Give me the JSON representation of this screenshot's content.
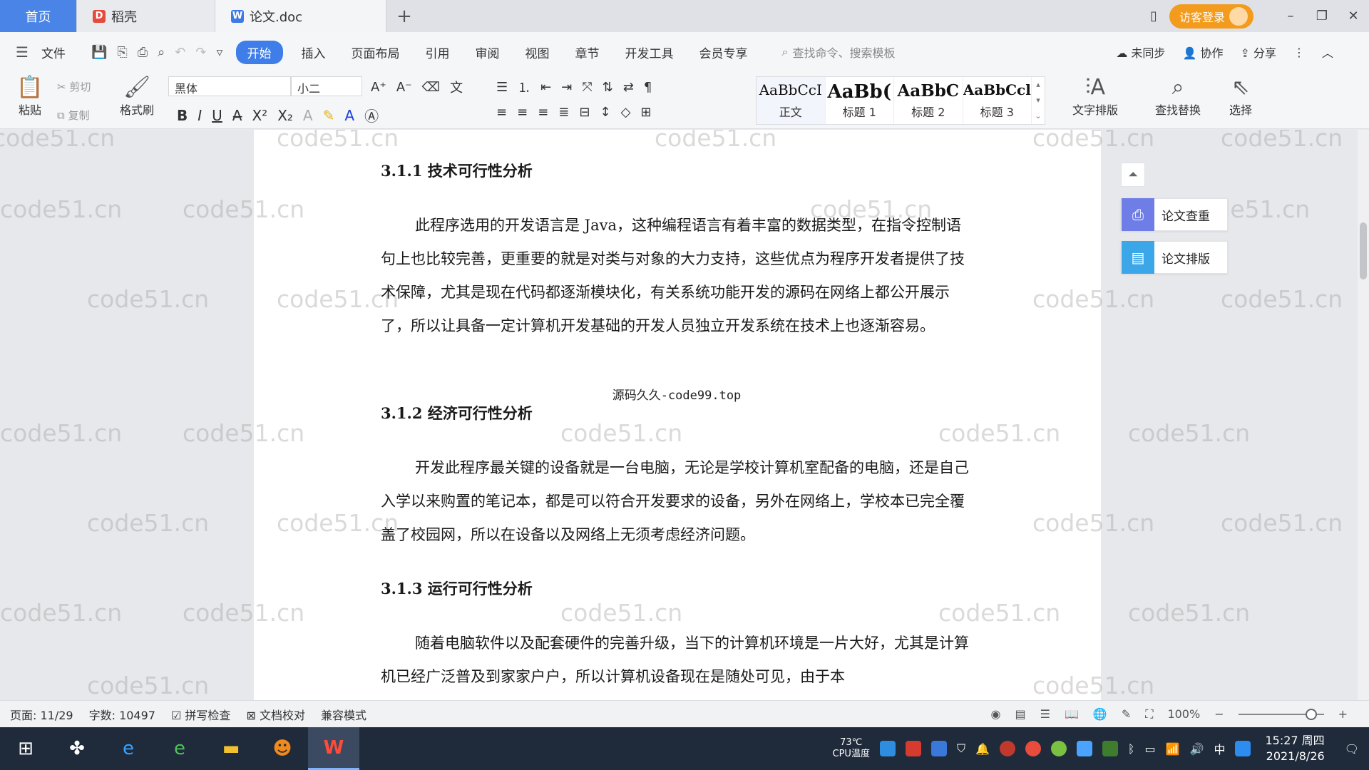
{
  "tabs": {
    "home": "首页",
    "daoke": "稻壳",
    "doc": "论文.doc",
    "add": "+"
  },
  "topright": {
    "login": "访客登录"
  },
  "menu": {
    "file": "文件",
    "items": [
      "开始",
      "插入",
      "页面布局",
      "引用",
      "审阅",
      "视图",
      "章节",
      "开发工具",
      "会员专享"
    ],
    "search_placeholder": "查找命令、搜索模板",
    "sync": "未同步",
    "collab": "协作",
    "share": "分享"
  },
  "ribbon": {
    "paste": "粘贴",
    "cut": "剪切",
    "copy": "复制",
    "format_painter": "格式刷",
    "font_name": "黑体",
    "font_size": "小二",
    "styles": [
      {
        "preview": "AaBbCcI",
        "label": "正文"
      },
      {
        "preview": "AaBb(",
        "label": "标题 1"
      },
      {
        "preview": "AaBbC",
        "label": "标题 2"
      },
      {
        "preview": "AaBbCcl",
        "label": "标题 3"
      }
    ],
    "text_layout": "文字排版",
    "find_replace": "查找替换",
    "select": "选择"
  },
  "watermark": "code51.cn",
  "document": {
    "h1": "3.1.1  技术可行性分析",
    "p1": "此程序选用的开发语言是 Java，这种编程语言有着丰富的数据类型，在指令控制语句上也比较完善，更重要的就是对类与对象的大力支持，这些优点为程序开发者提供了技术保障，尤其是现在代码都逐渐模块化，有关系统功能开发的源码在网络上都公开展示了，所以让具备一定计算机开发基础的开发人员独立开发系统在技术上也逐渐容易。",
    "note": "源码久久-code99.top",
    "h2": "3.1.2  经济可行性分析",
    "p2": "开发此程序最关键的设备就是一台电脑，无论是学校计算机室配备的电脑，还是自己入学以来购置的笔记本，都是可以符合开发要求的设备，另外在网络上，学校本已完全覆盖了校园网，所以在设备以及网络上无须考虑经济问题。",
    "h3": "3.1.3  运行可行性分析",
    "p3": "随着电脑软件以及配套硬件的完善升级，当下的计算机环境是一片大好，尤其是计算机已经广泛普及到家家户户，所以计算机设备现在是随处可见，由于本"
  },
  "side_panel": {
    "check": "论文查重",
    "layout": "论文排版"
  },
  "status": {
    "page": "页面: 11/29",
    "words": "字数: 10497",
    "spell": "拼写检查",
    "proof": "文档校对",
    "compat": "兼容模式",
    "zoom": "100%",
    "zoom_level_percent": 100
  },
  "taskbar": {
    "cpu_temp": "73℃",
    "cpu_label": "CPU温度",
    "ime": "中",
    "time": "15:27 周四",
    "date": "2021/8/26"
  }
}
